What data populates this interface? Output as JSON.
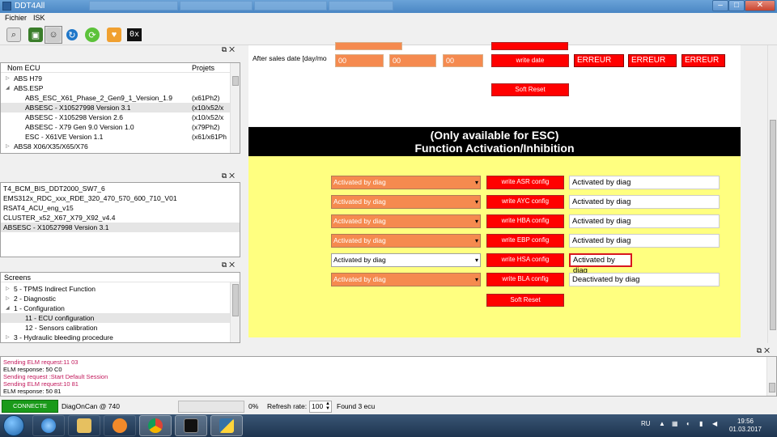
{
  "app": {
    "title": "DDT4All"
  },
  "menu": {
    "items": [
      "Fichier",
      "ISK"
    ]
  },
  "toolbar": {
    "hex_label": "0x"
  },
  "ecu_panel": {
    "col_name": "Nom ECU",
    "col_projects": "Projets",
    "rows": [
      {
        "name": "ABS H79",
        "proj": "",
        "indent": 1,
        "arrow": "▷"
      },
      {
        "name": "ABS.ESP",
        "proj": "",
        "indent": 1,
        "arrow": "◢"
      },
      {
        "name": "ABS_ESC_X61_Phase_2_Gen9_1_Version_1.9",
        "proj": "(x61Ph2)",
        "indent": 2
      },
      {
        "name": "ABSESC - X10527998 Version 3.1",
        "proj": "(x10/x52/x",
        "indent": 2,
        "selected": true
      },
      {
        "name": "ABSESC - X105298 Version 2.6",
        "proj": "(x10/x52/x",
        "indent": 2
      },
      {
        "name": "ABSESC - X79 Gen 9.0 Version 1.0",
        "proj": "(x79Ph2)",
        "indent": 2
      },
      {
        "name": "ESC - X61VE Version 1.1",
        "proj": "(x61/x61Ph",
        "indent": 2
      },
      {
        "name": "ABS8 X06/X35/X65/X76",
        "proj": "",
        "indent": 1,
        "arrow": "▷"
      }
    ]
  },
  "ecu_list": {
    "items": [
      "T4_BCM_BIS_DDT2000_SW7_6",
      "EMS312x_RDC_xxx_RDE_320_470_570_600_710_V01",
      "RSAT4_ACU_eng_v15",
      "CLUSTER_x52_X67_X79_X92_v4.4",
      "ABSESC - X10527998 Version 3.1"
    ]
  },
  "screens_panel": {
    "header": "Screens",
    "rows": [
      {
        "label": "5 - TPMS Indirect Function",
        "indent": 1,
        "arrow": "▷"
      },
      {
        "label": "2 - Diagnostic",
        "indent": 1,
        "arrow": "▷"
      },
      {
        "label": "1 - Configuration",
        "indent": 1,
        "arrow": "◢"
      },
      {
        "label": "11 - ECU configuration",
        "indent": 2,
        "selected": true
      },
      {
        "label": "12 - Sensors calibration",
        "indent": 2
      },
      {
        "label": "3 - Hydraulic bleeding procedure",
        "indent": 1,
        "arrow": "▷"
      }
    ]
  },
  "form": {
    "after_sales_label": "After sales date [day/mo",
    "date_fields": [
      "00",
      "00",
      "00"
    ],
    "write_date_label": "write date",
    "errors": [
      "ERREUR",
      "ERREUR",
      "ERREUR"
    ],
    "soft_reset_label": "Soft Reset",
    "banner_line1": "(Only available for ESC)",
    "banner_line2": "Function Activation/Inhibition",
    "config_rows": [
      {
        "combo": "Activated by diag",
        "button": "write ASR config",
        "readout": "Activated by diag",
        "combo_style": "orange"
      },
      {
        "combo": "Activated by diag",
        "button": "write AYC config",
        "readout": "Activated by diag",
        "combo_style": "orange"
      },
      {
        "combo": "Activated by diag",
        "button": "write HBA config",
        "readout": "Activated by diag",
        "combo_style": "orange"
      },
      {
        "combo": "Activated by diag",
        "button": "write EBP config",
        "readout": "Activated by diag",
        "combo_style": "orange"
      },
      {
        "combo": "Activated by diag",
        "button": "write HSA config",
        "readout": "Activated by diag",
        "combo_style": "white",
        "focused": true
      },
      {
        "combo": "Activated by diag",
        "button": "write BLA config",
        "readout": "Deactivated by diag",
        "combo_style": "orange"
      }
    ],
    "soft_reset_bottom_label": "Soft Reset"
  },
  "log": {
    "lines": [
      {
        "text": "Sending ELM request:11 03",
        "kind": "req"
      },
      {
        "text": "ELM response: 50 C0",
        "kind": "resp"
      },
      {
        "text": "Sending request :Start Default Session",
        "kind": "req"
      },
      {
        "text": "Sending ELM request:10 81",
        "kind": "req"
      },
      {
        "text": "ELM response: 50 81",
        "kind": "resp"
      }
    ]
  },
  "status": {
    "connection": "CONNECTE",
    "protocol": "DiagOnCan @ 740",
    "progress_pct": "0%",
    "progress_value": 0,
    "refresh_label": "Refresh rate:",
    "refresh_value": "100",
    "found": "Found 3 ecu"
  },
  "taskbar": {
    "language": "RU",
    "time": "19:56",
    "date": "01.03.2017"
  },
  "colors": {
    "orange": "#f58a4f",
    "red": "#ff0000",
    "yellow": "#ffff80",
    "connected": "#1a9a1a"
  }
}
